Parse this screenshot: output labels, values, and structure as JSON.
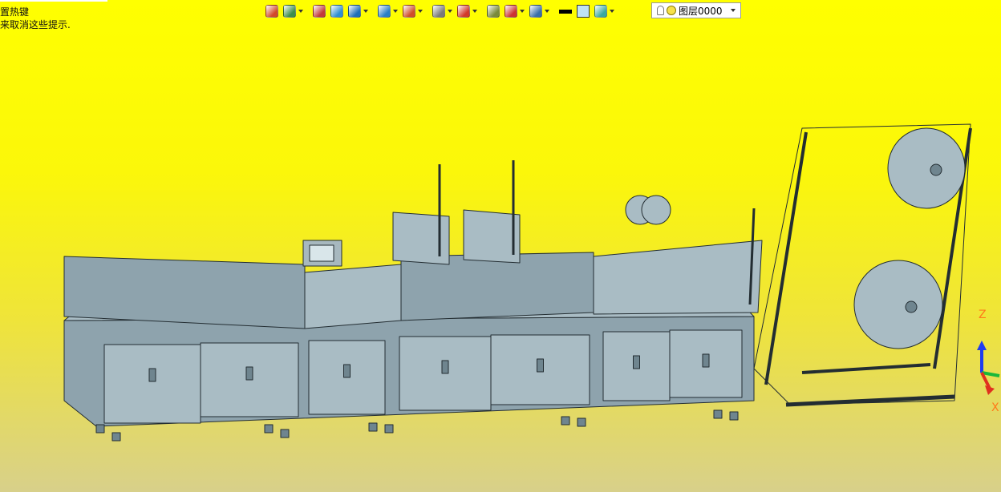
{
  "hint": {
    "line1": "置热键",
    "line2": "来取消这些提示."
  },
  "toolbar": [
    {
      "name": "exit-icon",
      "dropdown": false,
      "color": "#d24a2a"
    },
    {
      "name": "layer-tool-icon",
      "dropdown": true,
      "color": "#3d8f4b"
    },
    {
      "name": "pen-icon",
      "dropdown": false,
      "color": "#c23b3b"
    },
    {
      "name": "box-icon",
      "dropdown": false,
      "color": "#2f8fd0"
    },
    {
      "name": "solid-icon",
      "dropdown": true,
      "color": "#1f6fb8"
    },
    {
      "name": "view-cube-icon",
      "dropdown": true,
      "color": "#2a7fc5"
    },
    {
      "name": "sphere-icon",
      "dropdown": true,
      "color": "#d0502a"
    },
    {
      "name": "render-icon",
      "dropdown": true,
      "color": "#7a7a7a"
    },
    {
      "name": "snap-icon",
      "dropdown": true,
      "color": "#d23a2a"
    },
    {
      "name": "frame-icon",
      "dropdown": false,
      "color": "#7a8a3a"
    },
    {
      "name": "dimension-icon",
      "dropdown": true,
      "color": "#c33"
    },
    {
      "name": "image-icon",
      "dropdown": true,
      "color": "#3a6fa8"
    },
    {
      "name": "lineweight-icon",
      "dropdown": false,
      "color": "#000000"
    },
    {
      "name": "color-swatch-icon",
      "dropdown": false,
      "color": "#bfe3f5"
    },
    {
      "name": "layers-icon",
      "dropdown": true,
      "color": "#3aa9a0"
    }
  ],
  "layer_dropdown": {
    "value": "图层0000"
  },
  "axis": {
    "z": "Z",
    "x": "X"
  },
  "colors": {
    "machine_fill": "#8ea3ad",
    "machine_light": "#a9bcc4",
    "machine_line": "#232d32",
    "axis_z": "#1f3cf0",
    "axis_y": "#19b83a",
    "axis_x": "#e0301f"
  }
}
